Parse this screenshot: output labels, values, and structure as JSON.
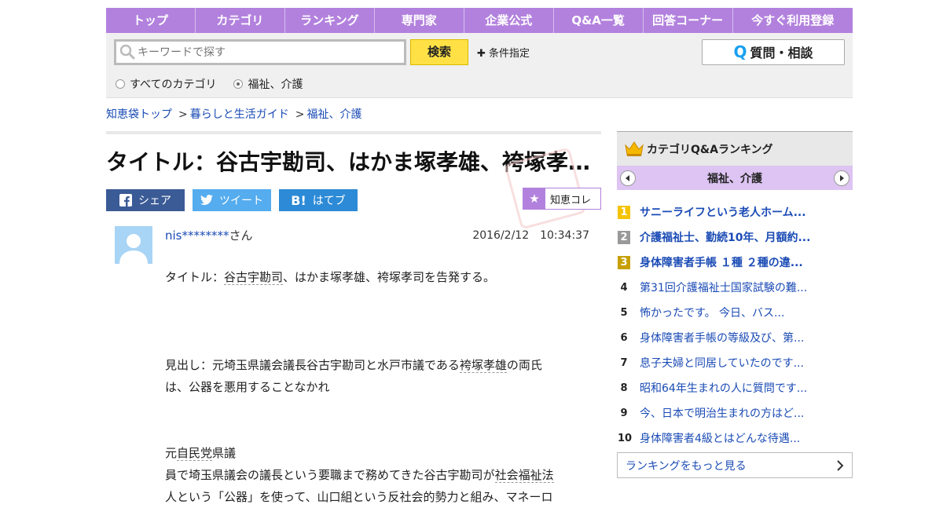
{
  "nav": [
    "トップ",
    "カテゴリ",
    "ランキング",
    "専門家",
    "企業公式",
    "Q&A一覧",
    "回答コーナー",
    "今すぐ利用登録"
  ],
  "search": {
    "placeholder": "キーワードで探す",
    "button": "検索",
    "conditions": "条件指定",
    "ask_button": "質問・相談",
    "radio_all": "すべてのカテゴリ",
    "radio_category": "福祉、介護"
  },
  "breadcrumb": [
    "知恵袋トップ",
    "暮らしと生活ガイド",
    "福祉、介護"
  ],
  "question": {
    "title": "タイトル：谷古宇勘司、はかま塚孝雄、袴塚孝…",
    "share": {
      "facebook": "シェア",
      "twitter": "ツイート",
      "hatena": "はてブ"
    },
    "collect": "知恵コレ",
    "user": "nis********",
    "user_suffix": "さん",
    "date": "2016/2/12　10:34:37",
    "body": {
      "p1_a": "タイトル：",
      "p1_kw": "谷古宇勘司",
      "p1_b": "、はかま塚孝雄、袴塚孝司を告発する。",
      "p2_a": "見出し：元埼玉県議会議長谷古宇勘司と水戸市議である",
      "p2_kw": "袴塚孝雄",
      "p2_b": "の両氏",
      "p2_c": "は、公器を悪用することなかれ",
      "p3_a": "元",
      "p3_kw": "自民党",
      "p3_b": "県議",
      "p4_a": "員で埼玉県議会の議長という要職まで務めてきた谷古宇勘司が",
      "p4_kw": "社会福祉法",
      "p5": "人という「公器」を使って、山口組という反社会的勢力と組み、マネーロ"
    }
  },
  "sidebar": {
    "title": "カテゴリQ&Aランキング",
    "category": "福祉、介護",
    "items": [
      {
        "rank": "1",
        "text": "サニーライフという老人ホーム..."
      },
      {
        "rank": "2",
        "text": "介護福祉士、勤続10年、月額約..."
      },
      {
        "rank": "3",
        "text": "身体障害者手帳 １種 ２種の違..."
      },
      {
        "rank": "4",
        "text": "第31回介護福祉士国家試験の難..."
      },
      {
        "rank": "5",
        "text": "怖かったです。 今日、バス..."
      },
      {
        "rank": "6",
        "text": "身体障害者手帳の等級及び、第..."
      },
      {
        "rank": "7",
        "text": "息子夫婦と同居していたのです..."
      },
      {
        "rank": "8",
        "text": "昭和64年生まれの人に質問です..."
      },
      {
        "rank": "9",
        "text": "今、日本で明治生まれの方はど..."
      },
      {
        "rank": "10",
        "text": "身体障害者4級とはどんな待遇..."
      }
    ],
    "more": "ランキングをもっと見る"
  },
  "colors": {
    "nav": "#b281dd",
    "accent": "#ffe146",
    "link": "#1a4bb5"
  }
}
